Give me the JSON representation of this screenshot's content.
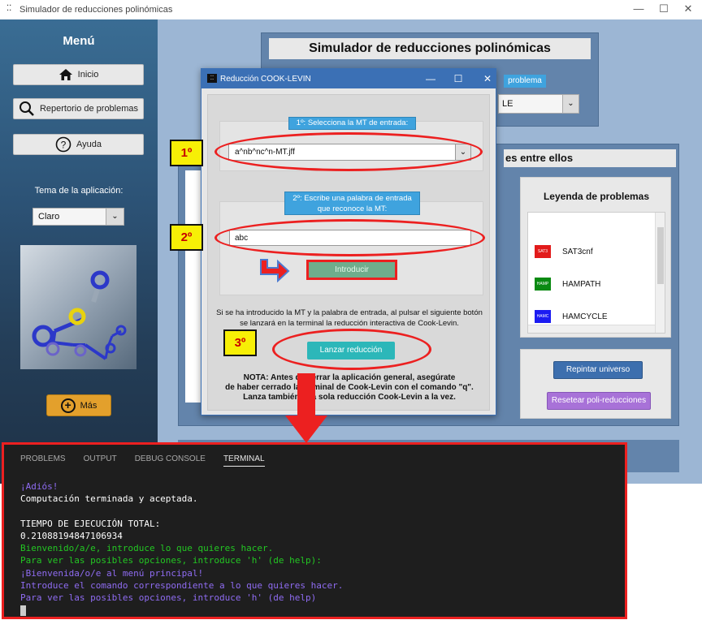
{
  "window": {
    "title": "Simulador de reducciones polinómicas",
    "controls": {
      "minimize": "—",
      "maximize": "☐",
      "close": "✕"
    }
  },
  "sidebar": {
    "menu_title": "Menú",
    "buttons": [
      {
        "label": "Inicio",
        "icon": "home-icon"
      },
      {
        "label": "Repertorio de problemas",
        "icon": "search-icon"
      },
      {
        "label": "Ayuda",
        "icon": "help-icon"
      }
    ],
    "theme_label": "Tema de la aplicación:",
    "theme_value": "Claro",
    "more_label": "Más"
  },
  "main": {
    "title": "Simulador de reducciones polinómicas",
    "problem_label": "problema",
    "problem_select_value": "LE",
    "universe_title": "es entre ellos",
    "legend": {
      "title": "Leyenda de problemas",
      "items": [
        {
          "badge": "SAT3",
          "name": "SAT3cnf",
          "color": "#e21b1b"
        },
        {
          "badge": "HAMP",
          "name": "HAMPATH",
          "color": "#0a8a12"
        },
        {
          "badge": "HAMC",
          "name": "HAMCYCLE",
          "color": "#1c1cf2"
        }
      ]
    },
    "repaint_label": "Repintar universo",
    "reset_label": "Resetear poli-reducciones"
  },
  "dialog": {
    "title": "Reducción COOK-LEVIN",
    "controls": {
      "minimize": "—",
      "maximize": "☐",
      "close": "✕"
    },
    "step1_label": "1º: Selecciona la MT de entrada:",
    "mt_value": "a^nb^nc^n-MT.jff",
    "step2_label_line1": "2º: Escribe una palabra de entrada",
    "step2_label_line2": "que reconoce la MT:",
    "word_value": "abc",
    "introduce_label": "Introducir",
    "info_line1": "Si se ha introducido la MT y la palabra de entrada, al pulsar el siguiente botón",
    "info_line2": "se lanzará en la terminal la reducción interactiva de Cook-Levin.",
    "launch_label": "Lanzar reducción",
    "note_line1": "NOTA: Antes de cerrar la aplicación general, asegúrate",
    "note_line2": "de haber cerrado la terminal de Cook-Levin con el comando \"q\".",
    "note_line3": "Lanza también una sola reducción Cook-Levin a la vez."
  },
  "annotations": {
    "step1": "1º",
    "step2": "2º",
    "step3": "3º"
  },
  "terminal": {
    "tabs": [
      "PROBLEMS",
      "OUTPUT",
      "DEBUG CONSOLE",
      "TERMINAL"
    ],
    "active_tab": "TERMINAL",
    "lines": [
      {
        "text": "¡Adiós!",
        "color": "#8f6cf2"
      },
      {
        "text": "Computación terminada y aceptada.",
        "color": "#ffffff"
      },
      {
        "text": " ",
        "color": "#ffffff"
      },
      {
        "text": "TIEMPO DE EJECUCIÓN TOTAL:",
        "color": "#ffffff"
      },
      {
        "text": "0.21088194847106934",
        "color": "#ffffff"
      },
      {
        "text": "Bienvenido/a/e, introduce lo que quieres hacer.",
        "color": "#23c623"
      },
      {
        "text": "Para ver las posibles opciones, introduce 'h' (de help):",
        "color": "#23c623"
      },
      {
        "text": "¡Bienvenida/o/e al menú principal!",
        "color": "#8f6cf2"
      },
      {
        "text": "Introduce el comando correspondiente a lo que quieres hacer.",
        "color": "#8f6cf2"
      },
      {
        "text": "Para ver las posibles opciones, introduce 'h' (de help)",
        "color": "#8f6cf2"
      }
    ]
  },
  "colors": {
    "accent": "#3b70b5",
    "annotation_red": "#ec2020",
    "badge_yellow": "#f7ef06"
  }
}
